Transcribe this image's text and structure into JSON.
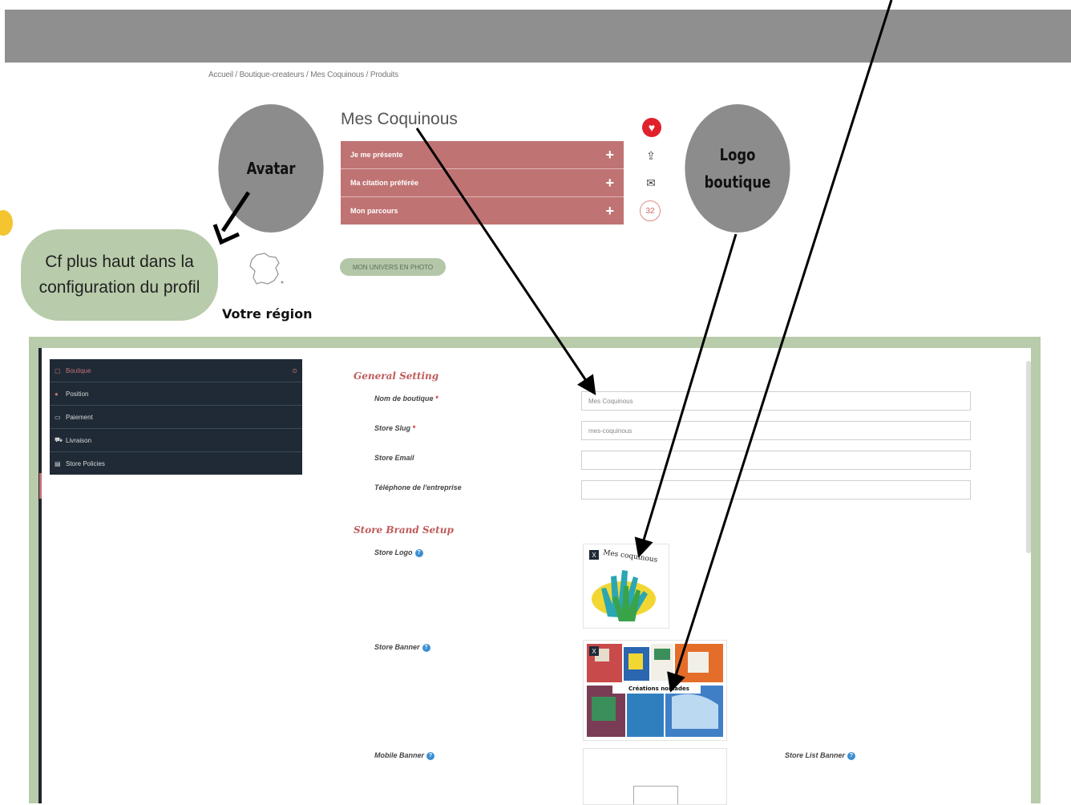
{
  "breadcrumb": "Accueil / Boutique-createurs / Mes Coquinous / Produits",
  "store": {
    "title": "Mes Coquinous",
    "accordion": [
      {
        "label": "Je me présente"
      },
      {
        "label": "Ma citation préférée"
      },
      {
        "label": "Mon parcours"
      }
    ],
    "plus_symbol": "+",
    "count_badge": "32",
    "univers_button": "MON UNIVERS EN PHOTO"
  },
  "annotations": {
    "avatar": "Avatar",
    "logo_line1": "Logo",
    "logo_line2": "boutique",
    "profile_note_line1": "Cf plus haut dans la",
    "profile_note_line2": "configuration du profil",
    "region": "Votre région"
  },
  "admin_menu": [
    {
      "label": "Boutique",
      "icon": "store-icon",
      "active": true
    },
    {
      "label": "Position",
      "icon": "location-icon"
    },
    {
      "label": "Paiement",
      "icon": "payment-icon"
    },
    {
      "label": "Livraison",
      "icon": "truck-icon"
    },
    {
      "label": "Store Policies",
      "icon": "policy-icon"
    }
  ],
  "general_setting": {
    "title": "General Setting",
    "fields": [
      {
        "label": "Nom de boutique",
        "required": true,
        "value": "Mes Coquinous"
      },
      {
        "label": "Store Slug",
        "required": true,
        "value": "mes-coquinous"
      },
      {
        "label": "Store Email",
        "required": false,
        "value": ""
      },
      {
        "label": "Téléphone de l'entreprise",
        "required": false,
        "value": ""
      }
    ]
  },
  "brand_setup": {
    "title": "Store Brand Setup",
    "store_logo_label": "Store Logo",
    "logo_image_text": "Mes coquinous",
    "store_banner_label": "Store Banner",
    "banner_image_text": "Créations nomades",
    "mobile_banner_label": "Mobile Banner",
    "store_list_banner_label": "Store List Banner"
  },
  "colors": {
    "accent": "#c07373",
    "green": "#b8cbaa",
    "menu_bg": "#1f2a36",
    "help_blue": "#3b8fd1"
  }
}
